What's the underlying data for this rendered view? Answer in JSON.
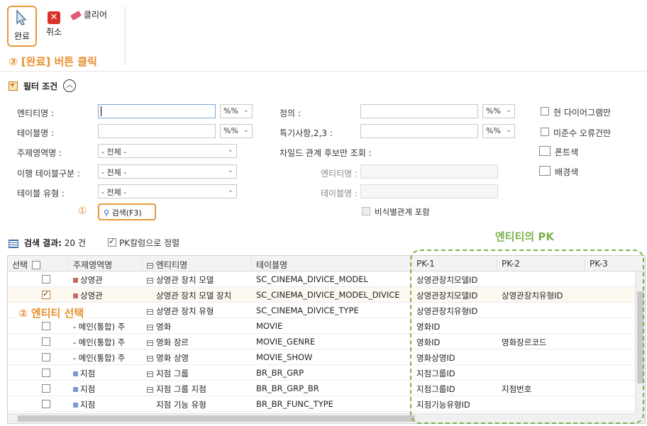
{
  "toolbar": {
    "done_label": "완료",
    "cancel_label": "취소",
    "clear_label": "클리어",
    "note": "③ [완료] 버튼 클릭"
  },
  "filter": {
    "title": "필터 조건",
    "entity_name_label": "엔티티명 :",
    "table_name_label": "테이블명 :",
    "subject_area_label": "주제영역명 :",
    "migration_table_label": "이행 테이블구분 :",
    "table_type_label": "테이블 유형 :",
    "match_option": "%%",
    "all_option": "- 전체 -",
    "definition_label": "정의 :",
    "special_label": "특기사항,2,3 :",
    "child_relation_label": "차일드 관계 후보만 조회 :",
    "child_entity_label": "엔티티명 :",
    "child_table_label": "테이블명 :",
    "search_label": "검색(F3)",
    "search_note": "①",
    "nonident_label": "비식별관계 포함",
    "current_diagram_label": "현 다이어그램만",
    "noncompliant_label": "미준수 오류건만",
    "font_color_label": "폰트색",
    "bg_color_label": "배경색"
  },
  "result": {
    "label": "검색 결과:",
    "count": "20 건",
    "sort_label": "PK칼럼으로 정렬",
    "pk_title": "엔티티의 PK",
    "select_note": "② 엔티티 선택"
  },
  "grid": {
    "headers": [
      "선택",
      "주제영역명",
      "엔티티명",
      "테이블명",
      "PK-1",
      "PK-2",
      "PK-3"
    ],
    "rows": [
      {
        "checked": false,
        "area": "상영관",
        "area_color": "#c96a6a",
        "entity": "상영관 장치 모델",
        "table": "SC_CINEMA_DIVICE_MODEL",
        "pk1": "상영관장치모델ID",
        "pk2": "",
        "pk3": ""
      },
      {
        "checked": true,
        "area": "상영관",
        "area_color": "#c96a6a",
        "entity": "상영관 장치 모델 장치",
        "table": "SC_CINEMA_DIVICE_MODEL_DIVICE",
        "pk1": "상영관장치모델ID",
        "pk2": "상영관장치유형ID",
        "pk3": ""
      },
      {
        "checked": false,
        "area": "관",
        "area_color": "",
        "entity": "상영관 장치 유형",
        "table": "SC_CINEMA_DIVICE_TYPE",
        "pk1": "상영관장치유형ID",
        "pk2": "",
        "pk3": ""
      },
      {
        "checked": false,
        "area": "- 메인(통합) 주",
        "area_color": "",
        "entity": "영화",
        "table": "MOVIE",
        "pk1": "영화ID",
        "pk2": "",
        "pk3": ""
      },
      {
        "checked": false,
        "area": "- 메인(통합) 주",
        "area_color": "",
        "entity": "영화 장르",
        "table": "MOVIE_GENRE",
        "pk1": "영화ID",
        "pk2": "영화장르코드",
        "pk3": ""
      },
      {
        "checked": false,
        "area": "- 메인(통합) 주",
        "area_color": "",
        "entity": "영화 상영",
        "table": "MOVIE_SHOW",
        "pk1": "영화상영ID",
        "pk2": "",
        "pk3": ""
      },
      {
        "checked": false,
        "area": "지점",
        "area_color": "#7a9bd0",
        "entity": "지점 그룹",
        "table": "BR_BR_GRP",
        "pk1": "지점그룹ID",
        "pk2": "",
        "pk3": ""
      },
      {
        "checked": false,
        "area": "지점",
        "area_color": "#7a9bd0",
        "entity": "지점 그룹 지점",
        "table": "BR_BR_GRP_BR",
        "pk1": "지점그룹ID",
        "pk2": "지점번호",
        "pk3": ""
      },
      {
        "checked": false,
        "area": "지점",
        "area_color": "#7a9bd0",
        "entity": "지점 기능 유형",
        "table": "BR_BR_FUNC_TYPE",
        "pk1": "지점기능유형ID",
        "pk2": "",
        "pk3": ""
      }
    ]
  },
  "colors": {
    "orange": "#e69a3c",
    "green": "#7cb24a",
    "search_blue": "#1a5fb4"
  }
}
